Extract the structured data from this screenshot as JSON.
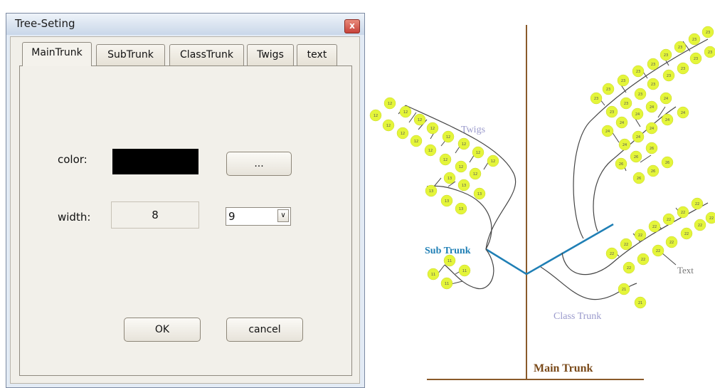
{
  "dialog": {
    "title": "Tree-Seting",
    "close_glyph": "x",
    "tabs": [
      "MainTrunk",
      "SubTrunk",
      "ClassTrunk",
      "Twigs",
      "text"
    ],
    "active_tab": "MainTrunk",
    "color_label": "color:",
    "color_value": "#000000",
    "browse_label": "...",
    "width_label": "width:",
    "width_value": "8",
    "width_select": "9",
    "ok_label": "OK",
    "cancel_label": "cancel"
  },
  "diagram": {
    "labels": {
      "twigs": "Twigs",
      "sub_trunk": "Sub Trunk",
      "class_trunk": "Class Trunk",
      "main_trunk": "Main Trunk",
      "text": "Text"
    },
    "leaf_numbers": {
      "group_12": "12",
      "group_13": "13",
      "group_11": "11",
      "group_23": "23",
      "group_24": "24",
      "group_26": "26",
      "group_22": "22",
      "group_21": "21"
    },
    "colors": {
      "main_trunk": "#8a5a2a",
      "sub_trunk": "#1f7fb5",
      "leaf": "#e4f53a",
      "branch": "#444444",
      "twigs_label": "#9a9acc",
      "class_label": "#9a9acc",
      "sub_label": "#1f7fb5",
      "main_label": "#7a4a1a",
      "text_label": "#777777"
    }
  }
}
